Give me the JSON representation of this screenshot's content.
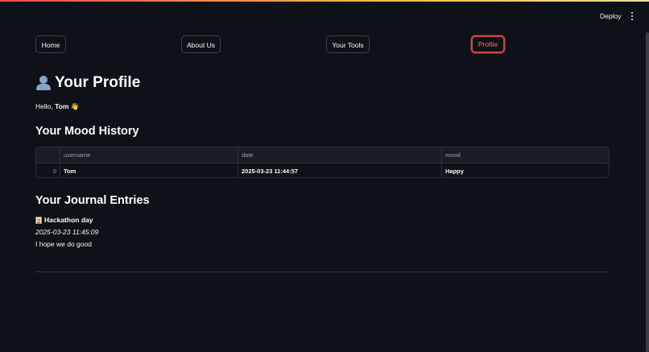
{
  "header": {
    "deploy_label": "Deploy",
    "menu_icon": "vertical-ellipsis-icon"
  },
  "nav": [
    {
      "label": "Home",
      "active": false
    },
    {
      "label": "About Us",
      "active": false
    },
    {
      "label": "Your Tools",
      "active": false
    },
    {
      "label": "Profile",
      "active": true
    }
  ],
  "page": {
    "title": "Your Profile",
    "title_icon": "user-silhouette-icon",
    "greeting_prefix": "Hello, ",
    "greeting_name": "Tom",
    "greeting_emoji": "👋"
  },
  "mood_history": {
    "title": "Your Mood History",
    "columns": [
      "",
      "username",
      "date",
      "mood"
    ],
    "rows": [
      {
        "index": "0",
        "username": "Tom",
        "date": "2025-03-23 11:44:57",
        "mood": "Happy"
      }
    ]
  },
  "journal": {
    "title": "Your Journal Entries",
    "entries": [
      {
        "icon": "memo-icon",
        "title": "Hackathon day",
        "date": "2025-03-23 11:45:09",
        "text": "I hope we do good"
      }
    ]
  },
  "colors": {
    "background": "#0e1117",
    "accent": "#ff4b4b",
    "text": "#fafafa"
  }
}
